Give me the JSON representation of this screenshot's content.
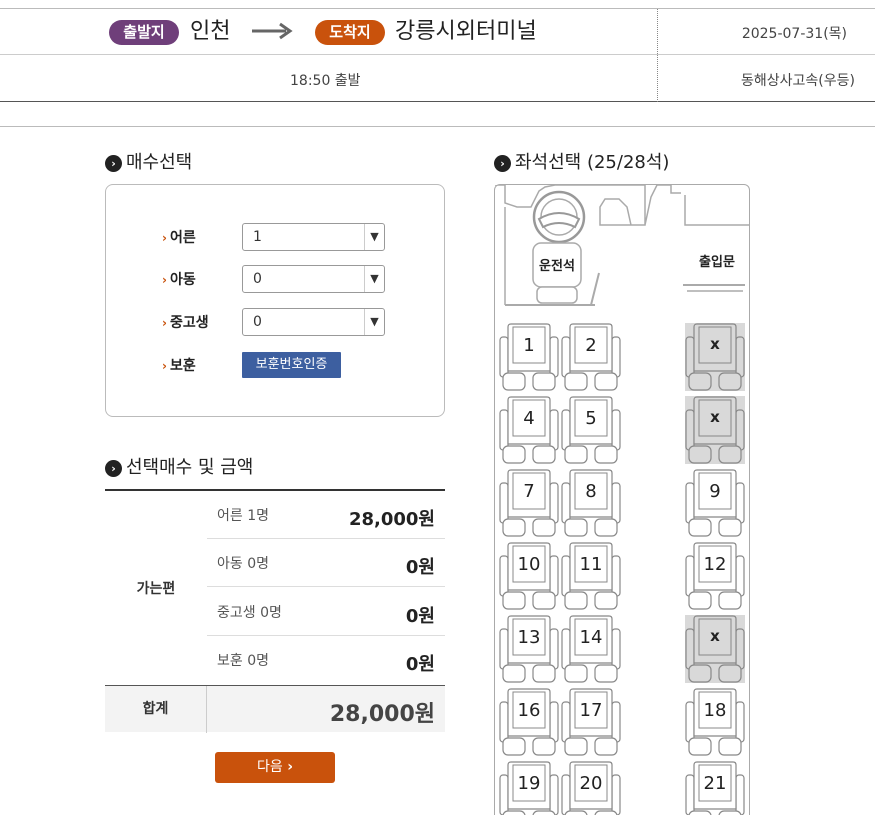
{
  "route": {
    "departure_badge": "출발지",
    "departure_city": "인천",
    "arrival_badge": "도착지",
    "arrival_city": "강릉시외터미널",
    "date": "2025-07-31(목)",
    "departure_time": "18:50 출발",
    "company": "동해상사고속(우등)"
  },
  "count_section": {
    "title": "매수선택",
    "rows": [
      {
        "label": "어른",
        "value": "1"
      },
      {
        "label": "아동",
        "value": "0"
      },
      {
        "label": "중고생",
        "value": "0"
      }
    ],
    "veteran_label": "보훈",
    "veteran_button": "보훈번호인증"
  },
  "summary_section": {
    "title": "선택매수 및 금액",
    "direction": "가는편",
    "rows": [
      {
        "name": "어른 1명",
        "amount": "28,000원"
      },
      {
        "name": "아동 0명",
        "amount": "0원"
      },
      {
        "name": "중고생 0명",
        "amount": "0원"
      },
      {
        "name": "보훈 0명",
        "amount": "0원"
      }
    ],
    "total_label": "합계",
    "total_amount": "28,000원"
  },
  "next_button": "다음",
  "seat_section": {
    "title": "좌석선택 (25/28석)",
    "driver_label": "운전석",
    "door_label": "출입문",
    "seats": [
      {
        "label": "1",
        "taken": false
      },
      {
        "label": "2",
        "taken": false
      },
      {
        "label": "x",
        "taken": true
      },
      {
        "label": "4",
        "taken": false
      },
      {
        "label": "5",
        "taken": false
      },
      {
        "label": "x",
        "taken": true
      },
      {
        "label": "7",
        "taken": false
      },
      {
        "label": "8",
        "taken": false
      },
      {
        "label": "9",
        "taken": false
      },
      {
        "label": "10",
        "taken": false
      },
      {
        "label": "11",
        "taken": false
      },
      {
        "label": "12",
        "taken": false
      },
      {
        "label": "13",
        "taken": false
      },
      {
        "label": "14",
        "taken": false
      },
      {
        "label": "x",
        "taken": true
      },
      {
        "label": "16",
        "taken": false
      },
      {
        "label": "17",
        "taken": false
      },
      {
        "label": "18",
        "taken": false
      },
      {
        "label": "19",
        "taken": false
      },
      {
        "label": "20",
        "taken": false
      },
      {
        "label": "21",
        "taken": false
      }
    ]
  },
  "colors": {
    "departure": "#6f3f7a",
    "arrival": "#c9520c",
    "next_button": "#c9520c",
    "veteran_button": "#3d5fa0",
    "taken_seat": "#d9d9d9"
  },
  "icons": {
    "section": "chevron-circle-icon",
    "route_arrow": "arrow-right-icon",
    "select_caret": "chevron-down-icon",
    "next": "chevron-right-icon"
  }
}
